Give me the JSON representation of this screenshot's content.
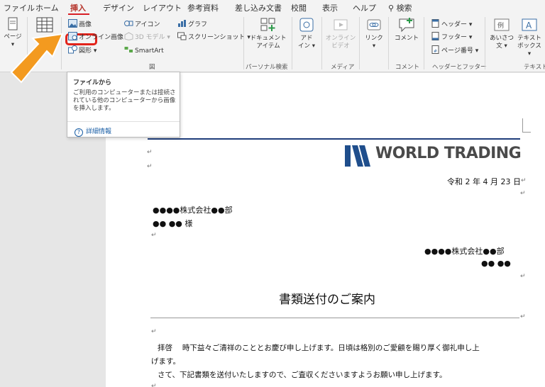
{
  "menu": {
    "tabs": [
      "ファイル",
      "ホーム",
      "挿入",
      "デザイン",
      "レイアウト",
      "参考資料",
      "差し込み文書",
      "校閲",
      "表示",
      "ヘルプ",
      "検索"
    ],
    "active": "挿入"
  },
  "ribbon": {
    "page_label": "ページ",
    "picture_label": "画像",
    "online_picture_label": "オンライン画像",
    "shapes_label": "図形",
    "icons_label": "アイコン",
    "model3d_label": "3D モデル",
    "smartart_label": "SmartArt",
    "chart_label": "グラフ",
    "screenshot_label": "スクリーンショット",
    "group_illust_label": "図",
    "doc_item_label_1": "ドキュメント",
    "doc_item_label_2": "アイテム",
    "group_personal_label": "パーソナル検索",
    "addin_label_1": "アド",
    "addin_label_2": "イン",
    "online_video_label_1": "オンライン",
    "online_video_label_2": "ビデオ",
    "group_media_label": "メディア",
    "link_label": "リンク",
    "comment_label": "コメント",
    "group_comment_label": "コメント",
    "header_label": "ヘッダー",
    "footer_label": "フッター",
    "page_number_label": "ページ番号",
    "group_header_footer_label": "ヘッダーとフッター",
    "greeting_label_1": "あいさつ",
    "greeting_label_2": "文",
    "textbox_label_1": "テキスト",
    "textbox_label_2": "ボックス",
    "group_text_label": "テキスト"
  },
  "tooltip": {
    "title": "ファイルから",
    "description": "ご利用のコンピューターまたは接続されている他のコンピューターから画像を挿入します。",
    "more": "詳細情報"
  },
  "document": {
    "logo_text": "WORLD TRADING",
    "date": "令和 2 年 4 月 23 日",
    "recipient_company": "●●●●株式会社●●部",
    "recipient_name": "●● ●● 様",
    "sender_company": "●●●●株式会社●●部",
    "sender_name": "●● ●●",
    "title": "書類送付のご案内",
    "body_line1": "拝啓　 時下益々ご清祥のこととお慶び申し上げます。日頃は格別のご愛顧を賜り厚く御礼申し上",
    "body_line2": "げます。",
    "body_line3": "さて、下記書類を送付いたしますので、ご査収くださいますようお願い申し上げます。"
  },
  "colors": {
    "accent_red": "#e2231a",
    "arrow_orange": "#f39a1f",
    "doc_rule_blue": "#1f3d7a",
    "logo_blue": "#1f4e8c"
  }
}
